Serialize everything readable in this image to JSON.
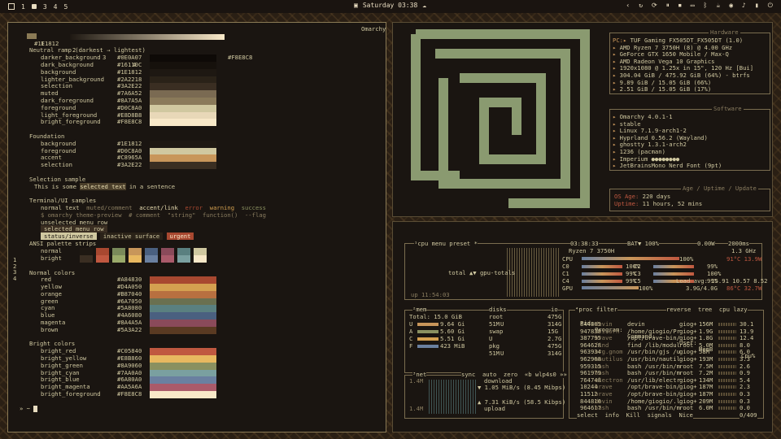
{
  "topbar": {
    "workspaces": [
      "1",
      "3",
      "4",
      "5"
    ],
    "clock": "Saturday 03:38"
  },
  "terminal": {
    "tabs": [
      "1",
      "2",
      "3",
      "4",
      "5",
      "+"
    ],
    "ramp_left": "#1E1812",
    "ramp_right": "#F8E8C8",
    "theme_name": "Omarchy",
    "neutral_title": "Neutral ramp (darkest → lightest)",
    "neutral": [
      {
        "name": "darker_background",
        "hex": "#0E0A07"
      },
      {
        "name": "dark_background",
        "hex": "#16110C"
      },
      {
        "name": "background",
        "hex": "#1E1812"
      },
      {
        "name": "lighter_background",
        "hex": "#2A2218"
      },
      {
        "name": "selection",
        "hex": "#3A2E22"
      },
      {
        "name": "muted",
        "hex": "#7A6A52"
      },
      {
        "name": "dark_foreground",
        "hex": "#8A7A5A"
      },
      {
        "name": "foreground",
        "hex": "#D0C8A0"
      },
      {
        "name": "light_foreground",
        "hex": "#E8D8B8"
      },
      {
        "name": "bright_foreground",
        "hex": "#F8E8C8"
      }
    ],
    "foundation_title": "Foundation",
    "foundation": [
      {
        "name": "background",
        "hex": "#1E1812"
      },
      {
        "name": "foreground",
        "hex": "#D0C8A0"
      },
      {
        "name": "accent",
        "hex": "#C8965A"
      },
      {
        "name": "selection",
        "hex": "#3A2E22"
      }
    ],
    "selection_title": "Selection sample",
    "selection_pre": "This is some ",
    "selection_word": "selected text",
    "selection_post": " in a sentence",
    "samples_title": "Terminal/UI samples",
    "sample_line1": [
      "normal text",
      "muted/comment",
      "accent/link",
      "error",
      "warning",
      "success"
    ],
    "sample_line2": "$ omarchy theme-preview  # comment  \"string\"  function()  --flag",
    "unselected_row": "unselected menu row",
    "selected_row": "selected menu row",
    "status_inverse": "status/inverse",
    "inactive_surface": "inactive surface",
    "urgent": "urgent",
    "ansi_title": "ANSI palette strips",
    "ansi_labels": [
      "normal",
      "bright"
    ],
    "ansi_normal": [
      "#1E1812",
      "#A84830",
      "#7A8A5A",
      "#C8965A",
      "#4A6080",
      "#8A4A5A",
      "#5A8080",
      "#D0C8A0"
    ],
    "ansi_bright": [
      "#3A2E22",
      "#C05840",
      "#9AAA6A",
      "#E8B860",
      "#6A80A0",
      "#AA5A6A",
      "#7AA0A0",
      "#F8E8C8"
    ],
    "normal_title": "Normal colors",
    "normal_colors": [
      {
        "name": "red",
        "hex": "#A84830"
      },
      {
        "name": "yellow",
        "hex": "#D4A050"
      },
      {
        "name": "orange",
        "hex": "#B87040"
      },
      {
        "name": "green",
        "hex": "#6A7050"
      },
      {
        "name": "cyan",
        "hex": "#5A8080"
      },
      {
        "name": "blue",
        "hex": "#4A6080"
      },
      {
        "name": "magenta",
        "hex": "#8A4A5A"
      },
      {
        "name": "brown",
        "hex": "#5A3A22"
      }
    ],
    "bright_title": "Bright colors",
    "bright_colors": [
      {
        "name": "bright_red",
        "hex": "#C05840"
      },
      {
        "name": "bright_yellow",
        "hex": "#E8B860"
      },
      {
        "name": "bright_green",
        "hex": "#8A9060"
      },
      {
        "name": "bright_cyan",
        "hex": "#7AA0A0"
      },
      {
        "name": "bright_blue",
        "hex": "#6A80A0"
      },
      {
        "name": "bright_magenta",
        "hex": "#AA5A6A"
      },
      {
        "name": "bright_foreground",
        "hex": "#F8E8C8"
      }
    ],
    "prompt": "» ~ ",
    "side_numbers": [
      "1",
      "2",
      "3",
      "4"
    ]
  },
  "fastfetch": {
    "hardware_title": "Hardware",
    "hardware": [
      {
        "key": "PC:",
        "value": "TUF Gaming FX505DT_FX505DT (1.0)"
      },
      {
        "key": "",
        "value": "AMD Ryzen 7 3750H (8) @ 4.00 GHz"
      },
      {
        "key": "",
        "value": "GeForce GTX 1650 Mobile / Max-Q"
      },
      {
        "key": "",
        "value": "AMD Radeon Vega 10 Graphics"
      },
      {
        "key": "",
        "value": "1920x1080 @ 1.25x in 15\", 120 Hz [Bui]"
      },
      {
        "key": "",
        "value": "304.04 GiB / 475.92 GiB (64%) - btrfs"
      },
      {
        "key": "",
        "value": "9.89 GiB / 15.05 GiB (66%)"
      },
      {
        "key": "",
        "value": "2.51 GiB / 15.05 GiB (17%)"
      }
    ],
    "software_title": "Software",
    "software": [
      "Omarchy 4.0.1-1",
      "stable",
      "Linux 7.1.9-arch1-2",
      "Hyprland 0.56.2 (Wayland)",
      "ghostty 1.3.1-arch2",
      "1236 (pacman)",
      "Imperium ●●●●●●●●",
      "JetBrainsMono Nerd Font (9pt)"
    ],
    "age_title": "Age / Uptime / Update",
    "os_age_label": "OS Age:",
    "os_age_value": "220 days",
    "uptime_label": "Uptime:",
    "uptime_value": "11 hours, 52 mins"
  },
  "btop": {
    "cpu_header": "¹cpu",
    "menu": "menu",
    "preset": "preset *",
    "time": "03:38:33",
    "battery": "BAT▼ 100%",
    "power": "0.00W",
    "interval": "2000ms",
    "cpu_model": "Ryzen 7 3750H",
    "freq": "1.3 GHz",
    "cpu_pct": "100%",
    "cpu_temp": "91°C 13.9W",
    "cores": [
      {
        "name": "C0",
        "pct": "100%",
        "name2": "C2",
        "pct2": "99%"
      },
      {
        "name": "C1",
        "pct": "99%",
        "name2": "C3",
        "pct2": "100%"
      },
      {
        "name": "C4",
        "pct": "99%",
        "name2": "C5",
        "pct2": "99%"
      }
    ],
    "load_avg": "Load avg: 15.91 10.57 8.52",
    "total_gpu": "total ▲▼ gpu-totals",
    "gpu_label": "GPU",
    "gpu_pct": "100%",
    "gpu_mem": "3.9G/4.0G",
    "gpu_temp": "86°C 32.7W",
    "uptime": "up 11:54:03",
    "mem_header": "²mem",
    "mem_total": "Total: 15.0 GiB",
    "mem_rows": [
      {
        "label": "U",
        "value": "9.64 Gi"
      },
      {
        "label": "A",
        "value": "5.60 Gi"
      },
      {
        "label": "C",
        "value": "5.51 Gi"
      },
      {
        "label": "F",
        "value": "423 MiB"
      }
    ],
    "disks_header": "disks",
    "io_label": "io",
    "disks": [
      {
        "name": "root",
        "size": "475G"
      },
      {
        "name": "51M",
        "extra": "U",
        "value": "314G"
      },
      {
        "name": "swap",
        "size": "15G"
      },
      {
        "name": "U",
        "value": "2.7G"
      },
      {
        "name": "pkg",
        "size": "475G"
      },
      {
        "name": "51M",
        "extra": "U",
        "value": "314G"
      }
    ],
    "net_header": "³net",
    "net_opts": "sync  auto  zero  «b wlp4s0 »»",
    "net_scale_top": "1.4M",
    "net_scale_bot": "1.4M",
    "download_label": "download",
    "download_rate": "▼ 1.05 MiB/s (8.45 Mibps)",
    "upload_rate": "▲ 7.31 KiB/s (58.5 Kibps)",
    "upload_label": "upload",
    "proc_header": "⁴proc",
    "proc_filter": "filter",
    "proc_opts": "reverse  tree  cpu lazy",
    "proc_columns": [
      "Pid:",
      "Program:",
      "Command:",
      "User:",
      "MemB",
      "Cpu%"
    ],
    "processes": [
      {
        "pid": "844805",
        "prog": "devin",
        "cmd": "devin",
        "user": "giog+",
        "mem": "156M",
        "cpu": "30.1"
      },
      {
        "pid": "947838",
        "prog": "uvicorn",
        "cmd": "/home/giogio/Pr",
        "user": "giog+",
        "mem": "1.9G",
        "cpu": "13.9"
      },
      {
        "pid": "387795",
        "prog": "brave",
        "cmd": "/opt/brave-bin/",
        "user": "giog+",
        "mem": "1.8G",
        "cpu": "12.4"
      },
      {
        "pid": "964628",
        "prog": "find",
        "cmd": "find /lib/modul",
        "user": "root",
        "mem": "5.0M",
        "cpu": "8.0"
      },
      {
        "pid": "963934",
        "prog": "org.gnom",
        "cmd": "/usr/bin/gjs /u",
        "user": "giog+",
        "mem": "58M",
        "cpu": "6.0"
      },
      {
        "pid": "962968",
        "prog": "nautilus",
        "cmd": "/usr/bin/nautil",
        "user": "giog+",
        "mem": "193M",
        "cpu": "3.3"
      },
      {
        "pid": "959315",
        "prog": "bash",
        "cmd": "bash /usr/bin/m",
        "user": "root",
        "mem": "7.5M",
        "cpu": "2.6"
      },
      {
        "pid": "961979",
        "prog": "bash",
        "cmd": "bash /usr/bin/m",
        "user": "root",
        "mem": "7.2M",
        "cpu": "0.9"
      },
      {
        "pid": "764748",
        "prog": "electron",
        "cmd": "/usr/lib/electr",
        "user": "giog+",
        "mem": "134M",
        "cpu": "5.4"
      },
      {
        "pid": "10244",
        "prog": "brave",
        "cmd": "/opt/brave-bin/",
        "user": "giog+",
        "mem": "187M",
        "cpu": "2.3"
      },
      {
        "pid": "11512",
        "prog": "brave",
        "cmd": "/opt/brave-bin/",
        "user": "giog+",
        "mem": "187M",
        "cpu": "0.3"
      },
      {
        "pid": "844816",
        "prog": "devin",
        "cmd": "/home/giogio/.l",
        "user": "giog+",
        "mem": "209M",
        "cpu": "0.3"
      },
      {
        "pid": "964617",
        "prog": "bash",
        "cmd": "bash /usr/bin/m",
        "user": "root",
        "mem": "6.0M",
        "cpu": "0.0"
      }
    ],
    "proc_footer_select": "select",
    "proc_footer_info": "info",
    "proc_footer_kill": "Kill",
    "proc_footer_signals": "signals",
    "proc_footer_nice": "Nice",
    "proc_count": "0/409"
  },
  "colors": {
    "accent": "#C8965A",
    "frame": "#8A7A55",
    "logo": "#8A9A70"
  }
}
